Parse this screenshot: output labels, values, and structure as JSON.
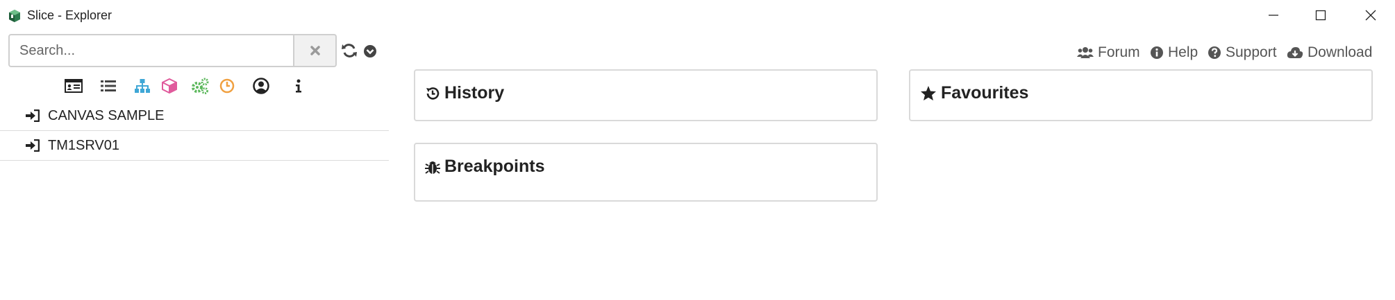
{
  "window": {
    "title": "Slice - Explorer",
    "controls": [
      "minimize",
      "maximize",
      "close"
    ]
  },
  "search": {
    "placeholder": "Search...",
    "value": ""
  },
  "toolbar_icons": [
    {
      "name": "id-card-icon",
      "color": "#222222"
    },
    {
      "name": "list-icon",
      "color": "#444444"
    },
    {
      "name": "sitemap-icon",
      "color": "#3fa7d6"
    },
    {
      "name": "cube-icon",
      "color": "#e05a9c"
    },
    {
      "name": "cogs-icon",
      "color": "#5cb85c"
    },
    {
      "name": "clock-icon",
      "color": "#f0a040"
    },
    {
      "name": "user-circle-icon",
      "color": "#222222"
    },
    {
      "name": "info-icon",
      "color": "#222222"
    }
  ],
  "nav": {
    "items": [
      {
        "label": "CANVAS SAMPLE",
        "icon": "sign-in-icon"
      },
      {
        "label": "TM1SRV01",
        "icon": "sign-in-icon"
      }
    ]
  },
  "top_links": {
    "forum": "Forum",
    "help": "Help",
    "support": "Support",
    "download": "Download"
  },
  "panels": {
    "history": "History",
    "favourites": "Favourites",
    "breakpoints": "Breakpoints"
  },
  "colors": {
    "app_icon": "#2e7d4f",
    "link": "#555555",
    "border": "#d9d9d9"
  }
}
